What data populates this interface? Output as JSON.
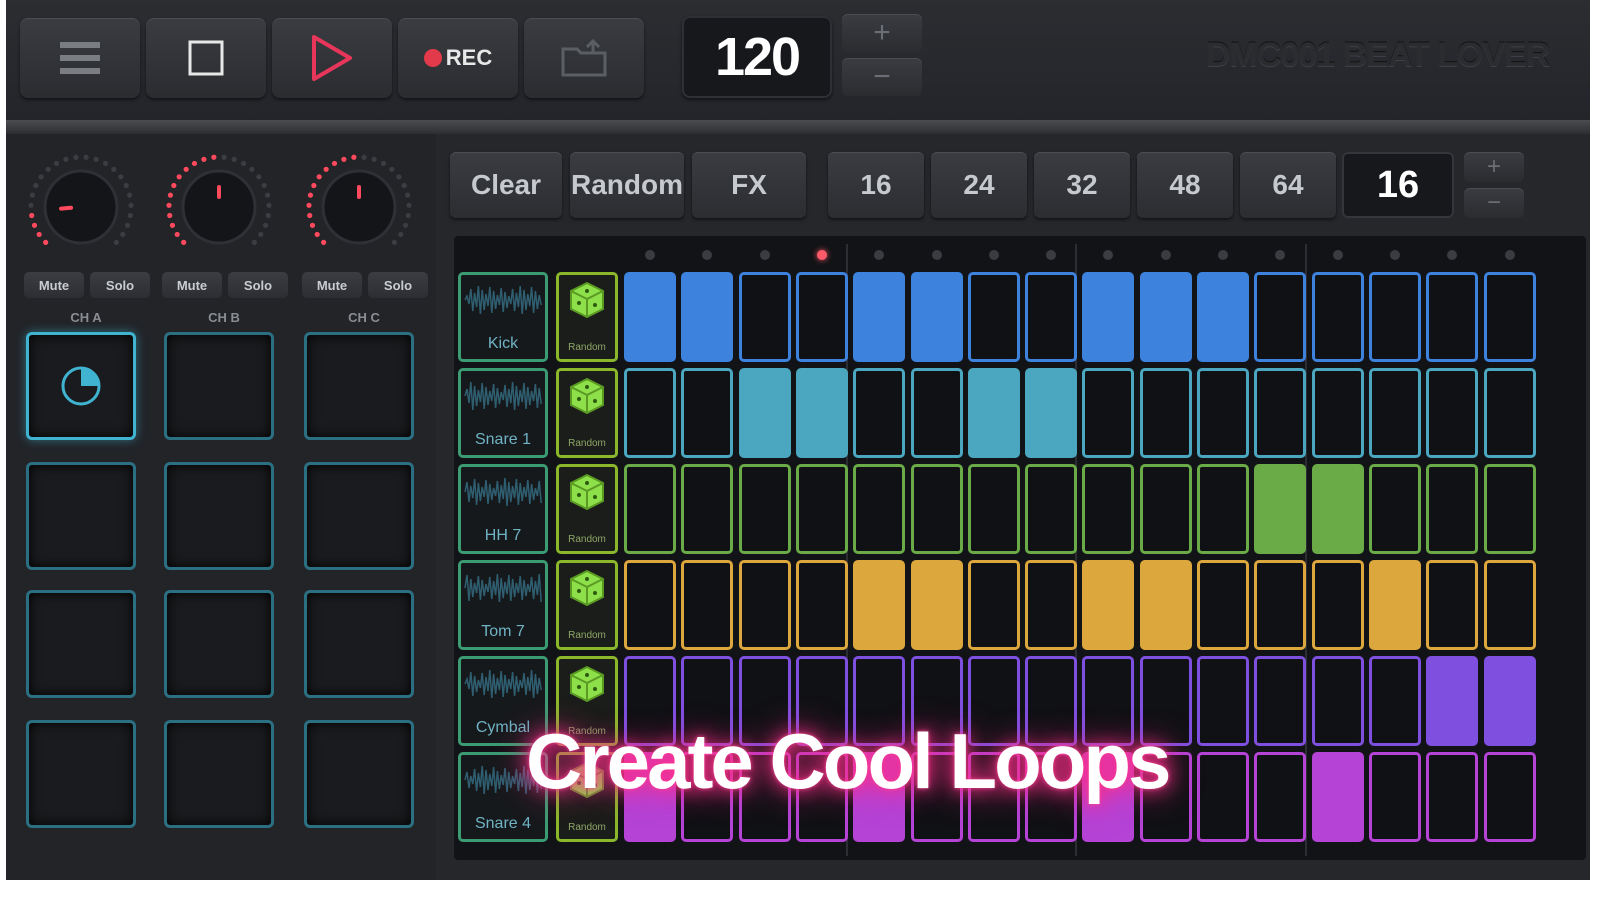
{
  "toolbar": {
    "menu_icon": "menu-icon",
    "stop_icon": "stop-icon",
    "play_icon": "play-icon",
    "rec_label": "REC",
    "open_icon": "folder-open-icon",
    "bpm": "120",
    "plus": "+",
    "minus": "−",
    "title": "DMC001 BEAT LOVER"
  },
  "channels": [
    {
      "label": "CH A",
      "mute": "Mute",
      "solo": "Solo",
      "knob_level": 0.15
    },
    {
      "label": "CH B",
      "mute": "Mute",
      "solo": "Solo",
      "knob_level": 0.5
    },
    {
      "label": "CH C",
      "mute": "Mute",
      "solo": "Solo",
      "knob_level": 0.5
    }
  ],
  "controls": {
    "clear": "Clear",
    "random": "Random",
    "fx": "FX",
    "lengths": [
      "16",
      "24",
      "32",
      "48",
      "64"
    ],
    "current_length": "16",
    "plus": "+",
    "minus": "−"
  },
  "sequencer": {
    "current_step": 4,
    "random_label": "Random",
    "tracks": [
      {
        "name": "Kick",
        "color": "#3d83de",
        "steps": [
          1,
          1,
          0,
          0,
          1,
          1,
          0,
          0,
          1,
          1,
          1,
          0,
          0,
          0,
          0,
          0
        ]
      },
      {
        "name": "Snare 1",
        "color": "#4aa7bf",
        "steps": [
          0,
          0,
          1,
          1,
          0,
          0,
          1,
          1,
          0,
          0,
          0,
          0,
          0,
          0,
          0,
          0
        ]
      },
      {
        "name": "HH 7",
        "color": "#6aab48",
        "steps": [
          0,
          0,
          0,
          0,
          0,
          0,
          0,
          0,
          0,
          0,
          0,
          1,
          1,
          0,
          0,
          0
        ]
      },
      {
        "name": "Tom 7",
        "color": "#dca83e",
        "steps": [
          0,
          0,
          0,
          0,
          1,
          1,
          0,
          0,
          1,
          1,
          0,
          0,
          0,
          1,
          0,
          0
        ]
      },
      {
        "name": "Cymbal",
        "color": "#7f4fe0",
        "steps": [
          0,
          0,
          0,
          0,
          0,
          0,
          0,
          0,
          0,
          0,
          0,
          0,
          0,
          0,
          1,
          1
        ]
      },
      {
        "name": "Snare 4",
        "color": "#b443d6",
        "steps": [
          1,
          0,
          0,
          0,
          1,
          0,
          0,
          0,
          1,
          0,
          0,
          0,
          1,
          0,
          0,
          0
        ]
      }
    ]
  },
  "overlay_text": "Create Cool Loops"
}
